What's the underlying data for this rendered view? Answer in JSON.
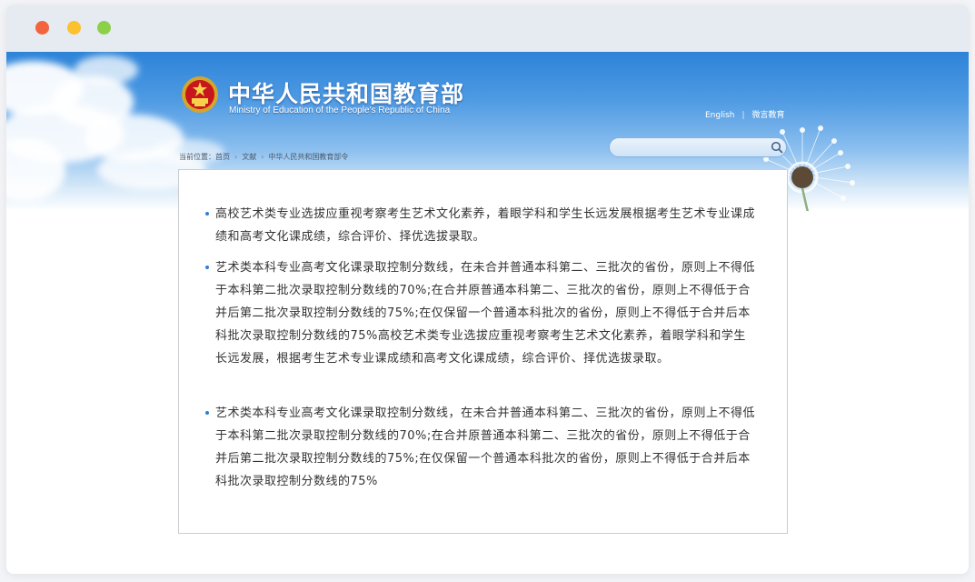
{
  "window": {
    "controls": [
      "close",
      "minimize",
      "maximize"
    ]
  },
  "header": {
    "title_zh": "中华人民共和国教育部",
    "title_en": "Ministry of Education of the People's Republic of China",
    "emblem_icon": "national-emblem-icon",
    "links": {
      "english": "English",
      "separator": "|",
      "weiyan": "微言教育"
    },
    "search": {
      "placeholder": "",
      "value": "",
      "icon": "search-icon"
    }
  },
  "breadcrumb": {
    "prefix": "当前位置：",
    "items": [
      "首页",
      "文献",
      "中华人民共和国教育部令"
    ]
  },
  "content": {
    "paragraphs": [
      "高校艺术类专业选拔应重视考察考生艺术文化素养，着眼学科和学生长远发展根据考生艺术专业课成绩和高考文化课成绩，综合评价、择优选拔录取。",
      "艺术类本科专业高考文化课录取控制分数线，在未合并普通本科第二、三批次的省份，原则上不得低于本科第二批次录取控制分数线的70%;在合并原普通本科第二、三批次的省份，原则上不得低于合并后第二批次录取控制分数线的75%;在仅保留一个普通本科批次的省份，原则上不得低于合并后本科批次录取控制分数线的75%高校艺术类专业选拔应重视考察考生艺术文化素养，着眼学科和学生长远发展，根据考生艺术专业课成绩和高考文化课成绩，综合评价、择优选拔录取。",
      "艺术类本科专业高考文化课录取控制分数线，在未合并普通本科第二、三批次的省份，原则上不得低于本科第二批次录取控制分数线的70%;在合并原普通本科第二、三批次的省份，原则上不得低于合并后第二批次录取控制分数线的75%;在仅保留一个普通本科批次的省份，原则上不得低于合并后本科批次录取控制分数线的75%"
    ]
  },
  "colors": {
    "banner_top": "#2d83d8",
    "bullet": "#2f7ed8",
    "text": "#333333"
  }
}
